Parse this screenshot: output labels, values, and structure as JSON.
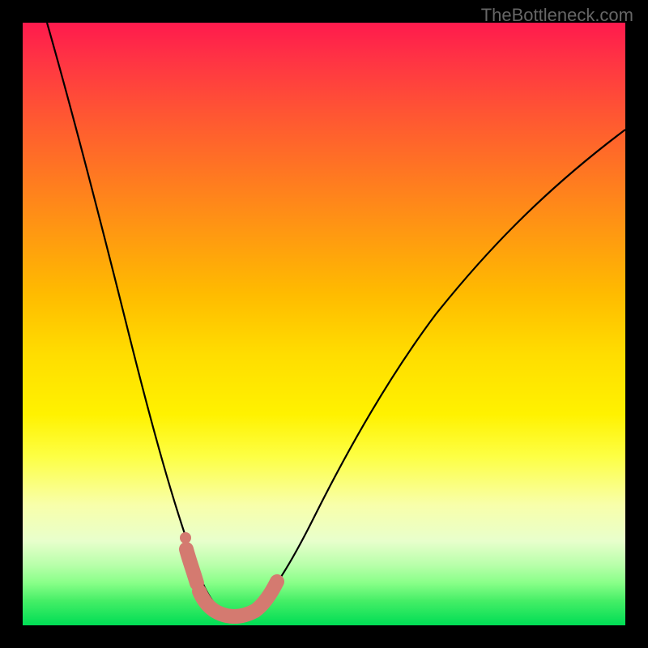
{
  "watermark": "TheBottleneck.com",
  "chart_data": {
    "type": "line",
    "title": "",
    "xlabel": "",
    "ylabel": "",
    "xlim": [
      0,
      1
    ],
    "ylim": [
      0,
      1
    ],
    "description": "V-shaped bottleneck curve on rainbow gradient, minimum at approx x=0.34",
    "series": [
      {
        "name": "bottleneck-curve",
        "x": [
          0.04,
          0.08,
          0.12,
          0.16,
          0.2,
          0.24,
          0.27,
          0.3,
          0.32,
          0.34,
          0.36,
          0.38,
          0.42,
          0.48,
          0.55,
          0.62,
          0.7,
          0.8,
          0.9,
          1.0
        ],
        "y": [
          1.0,
          0.88,
          0.74,
          0.6,
          0.46,
          0.31,
          0.18,
          0.08,
          0.03,
          0.02,
          0.03,
          0.07,
          0.17,
          0.3,
          0.42,
          0.52,
          0.62,
          0.72,
          0.8,
          0.86
        ]
      }
    ],
    "highlight": {
      "note": "thick salmon segment near minimum",
      "x_range": [
        0.28,
        0.4
      ],
      "color": "#d47a70"
    },
    "background_gradient": {
      "top": "#ff1a4d",
      "middle": "#ffee00",
      "bottom": "#00dd55"
    }
  }
}
